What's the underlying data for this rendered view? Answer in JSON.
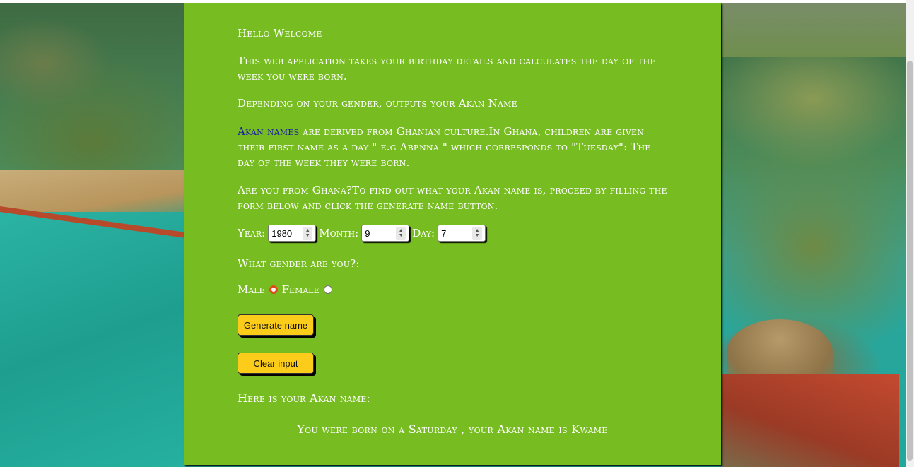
{
  "intro": {
    "title": "Hello Welcome",
    "line1": "This web application takes your birthday details and calculates the day of the week you were born.",
    "line2": "Depending on your gender, outputs your Akan Name",
    "akan_link": "Akan names",
    "line3_rest": " are derived from Ghanian culture.In Ghana, children are given their first name as a day \" e.g Abenna \" which corresponds to \"Tuesday\": The day of the week they were born.",
    "line4": "Are you from Ghana?To find out what your Akan name is, proceed by filling the form below and click the generate name button."
  },
  "form": {
    "year_label": "Year:",
    "year_value": "1980",
    "month_label": "Month:",
    "month_value": "9",
    "day_label": "Day:",
    "day_value": "7",
    "gender_question": "What gender are you?:",
    "male_label": "Male",
    "female_label": "Female",
    "selected_gender": "Male",
    "generate_button": "Generate name",
    "clear_button": "Clear input"
  },
  "output": {
    "heading": "Here is your Akan name:",
    "result": "You were born on a Saturday , your Akan name is Kwame"
  },
  "colors": {
    "panel": "#77bd21",
    "button": "#fccc1a",
    "radio_checked": "#e24a1a"
  }
}
